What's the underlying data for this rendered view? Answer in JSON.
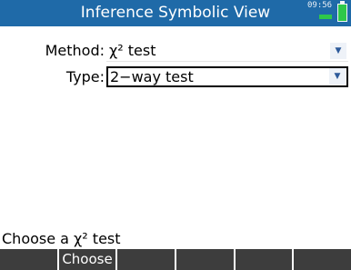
{
  "app": {
    "title": "Inference Symbolic View",
    "clock": "09:56",
    "battery_color": "#2ec84a",
    "titlebar_color": "#1f6aa8"
  },
  "form": {
    "method_label": "Method:",
    "method_value": "χ² test",
    "type_label": "Type:",
    "type_value": "2−way test"
  },
  "help": "Choose a χ² test",
  "softkeys": [
    "",
    "Choose",
    "",
    "",
    "",
    ""
  ]
}
